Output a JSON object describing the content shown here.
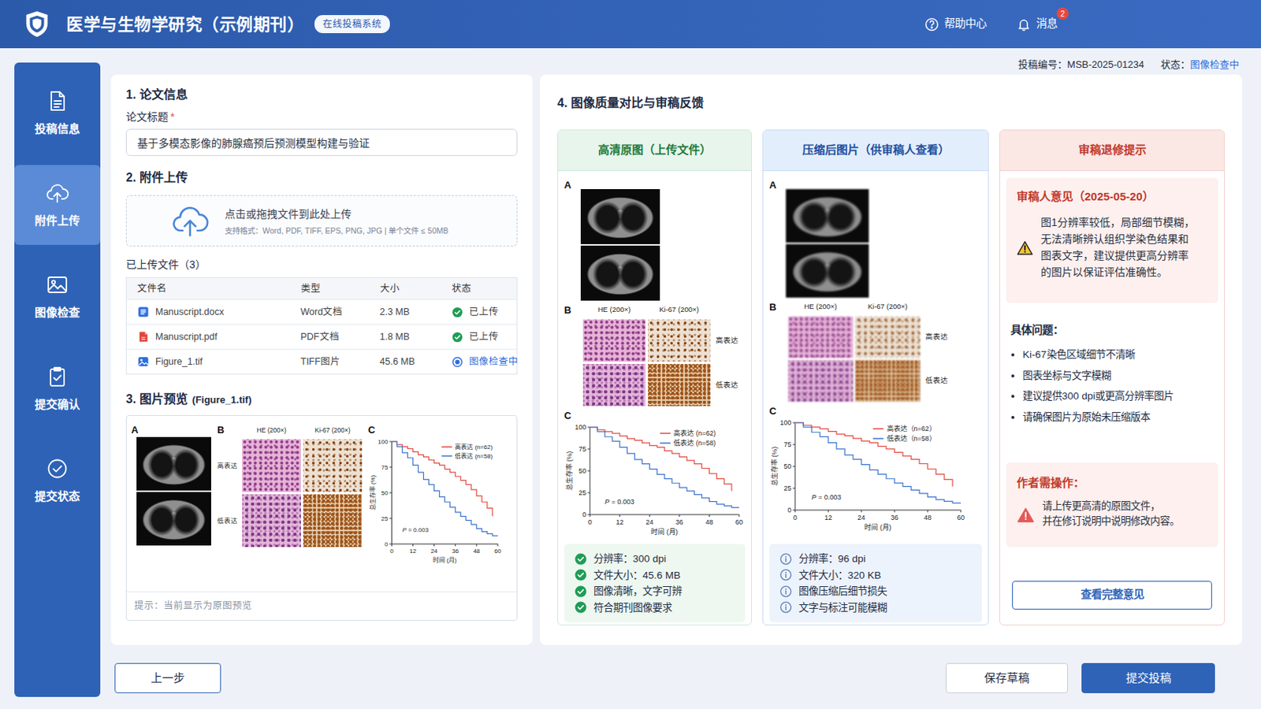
{
  "header": {
    "title": "医学与生物学研究（示例期刊）",
    "badge": "在线投稿系统",
    "help": "帮助中心",
    "messages": "消息",
    "message_count": "2"
  },
  "sidebar": {
    "items": [
      {
        "label": "投稿信息",
        "selected": false
      },
      {
        "label": "附件上传",
        "selected": true
      },
      {
        "label": "图像检查",
        "selected": false
      },
      {
        "label": "提交确认",
        "selected": false
      },
      {
        "label": "提交状态",
        "selected": false
      }
    ]
  },
  "submission": {
    "id_label": "投稿编号：",
    "id": "MSB-2025-01234",
    "status_label": "状态：",
    "status": "图像检查中"
  },
  "paper_info": {
    "heading": "1. 论文信息",
    "title_label": "论文标题",
    "required_mark": "*",
    "title_value": "基于多模态影像的肺腺癌预后预测模型构建与验证"
  },
  "upload": {
    "heading": "2. 附件上传",
    "drop_text": "点击或拖拽文件到此处上传",
    "drop_hint": "支持格式：Word, PDF, TIFF, EPS, PNG, JPG | 单个文件 ≤ 50MB"
  },
  "files": {
    "heading": "已上传文件（3）",
    "columns": [
      "文件名",
      "类型",
      "大小",
      "状态"
    ],
    "rows": [
      {
        "name": "Manuscript.docx",
        "type": "Word文档",
        "size": "2.3 MB",
        "status": "已上传",
        "kind": "word",
        "state": "done"
      },
      {
        "name": "Manuscript.pdf",
        "type": "PDF文档",
        "size": "1.8 MB",
        "status": "已上传",
        "kind": "pdf",
        "state": "done"
      },
      {
        "name": "Figure_1.tif",
        "type": "TIFF图片",
        "size": "45.6 MB",
        "status": "图像检查中",
        "kind": "image",
        "state": "checking"
      }
    ]
  },
  "preview": {
    "heading": "3. 图片预览",
    "file": "(Figure_1.tif)",
    "hint": "提示：当前显示为原图预览",
    "figure": {
      "a": "A",
      "b": "B",
      "c": "C",
      "he": "HE (200×)",
      "ki": "Ki-67 (200×)",
      "high": "高表达",
      "low": "低表达",
      "blurred": false,
      "chart": {
        "y_title": "总生存率 (%)",
        "x_title": "时间 (月)",
        "y_ticks": [
          "0",
          "25",
          "50",
          "75",
          "100"
        ],
        "x_ticks": [
          "0",
          "12",
          "24",
          "36",
          "48",
          "60"
        ],
        "p_label": "P",
        "p_value": "= 0.003",
        "series": [
          {
            "name": "高表达 (n=62)",
            "color": "#e5483f",
            "times": [
              0,
              3,
              6,
              9,
              12,
              15,
              18,
              21,
              24,
              27,
              30,
              33,
              36,
              39,
              42,
              45,
              48,
              51,
              54,
              57
            ],
            "values": [
              100,
              97,
              95,
              93,
              90,
              87,
              85,
              82,
              79,
              77,
              73,
              70,
              66,
              62,
              58,
              53,
              47,
              41,
              35,
              27
            ]
          },
          {
            "name": "低表达 (n=58)",
            "color": "#3a73cf",
            "times": [
              0,
              3,
              6,
              9,
              12,
              15,
              18,
              21,
              24,
              27,
              30,
              33,
              36,
              39,
              42,
              45,
              48,
              51,
              54,
              57,
              60
            ],
            "values": [
              100,
              95,
              89,
              84,
              77,
              70,
              63,
              58,
              52,
              46,
              41,
              36,
              31,
              27,
              23,
              19,
              15,
              12,
              10,
              8,
              8
            ]
          }
        ]
      }
    }
  },
  "compare": {
    "heading": "4. 图像质量对比与审稿反馈",
    "original": {
      "title": "高清原图（上传文件）",
      "figure": {
        "a": "A",
        "b": "B",
        "c": "C",
        "he": "HE (200×)",
        "ki": "Ki-67 (200×)",
        "high": "高表达",
        "low": "低表达",
        "blurred": false,
        "chart": {
          "y_title": "总生存率 (%)",
          "x_title": "时间 (月)",
          "y_ticks": [
            "0",
            "25",
            "50",
            "75",
            "100"
          ],
          "x_ticks": [
            "0",
            "12",
            "24",
            "36",
            "48",
            "60"
          ],
          "p_label": "P",
          "p_value": "= 0.003",
          "series": [
            {
              "name": "高表达 (n=62)",
              "color": "#e5483f",
              "times": [
                0,
                3,
                6,
                9,
                12,
                15,
                18,
                21,
                24,
                27,
                30,
                33,
                36,
                39,
                42,
                45,
                48,
                51,
                54,
                57
              ],
              "values": [
                100,
                97,
                95,
                93,
                90,
                87,
                85,
                82,
                79,
                77,
                73,
                70,
                66,
                62,
                58,
                53,
                47,
                41,
                35,
                27
              ]
            },
            {
              "name": "低表达 (n=58)",
              "color": "#3a73cf",
              "times": [
                0,
                3,
                6,
                9,
                12,
                15,
                18,
                21,
                24,
                27,
                30,
                33,
                36,
                39,
                42,
                45,
                48,
                51,
                54,
                57,
                60
              ],
              "values": [
                100,
                95,
                89,
                84,
                77,
                70,
                63,
                58,
                52,
                46,
                41,
                36,
                31,
                27,
                23,
                19,
                15,
                12,
                10,
                8,
                8
              ]
            }
          ]
        }
      },
      "checks": [
        {
          "text": "分辨率：300 dpi",
          "kind": "ok"
        },
        {
          "text": "文件大小：45.6 MB",
          "kind": "ok"
        },
        {
          "text": "图像清晰，文字可辨",
          "kind": "ok"
        },
        {
          "text": "符合期刊图像要求",
          "kind": "ok"
        }
      ]
    },
    "compressed": {
      "title": "压缩后图片（供审稿人查看）",
      "figure": {
        "a": "A",
        "b": "B",
        "c": "C",
        "he": "HE (200×)",
        "ki": "Ki-67 (200×)",
        "high": "高表达",
        "low": "低表达",
        "blurred": true,
        "chart": {
          "y_title": "总生存率 (%)",
          "x_title": "时间 (月)",
          "y_ticks": [
            "0",
            "25",
            "50",
            "75",
            "100"
          ],
          "x_ticks": [
            "0",
            "12",
            "24",
            "36",
            "48",
            "60"
          ],
          "p_label": "P",
          "p_value": "= 0.003",
          "series": [
            {
              "name": "高表达（n=62）",
              "color": "#e5483f",
              "times": [
                0,
                3,
                6,
                9,
                12,
                15,
                18,
                21,
                24,
                27,
                30,
                33,
                36,
                39,
                42,
                45,
                48,
                51,
                54,
                57
              ],
              "values": [
                100,
                97,
                95,
                93,
                90,
                87,
                85,
                82,
                79,
                77,
                73,
                70,
                66,
                62,
                58,
                53,
                47,
                41,
                35,
                27
              ]
            },
            {
              "name": "低表达（n=58）",
              "color": "#3a73cf",
              "times": [
                0,
                3,
                6,
                9,
                12,
                15,
                18,
                21,
                24,
                27,
                30,
                33,
                36,
                39,
                42,
                45,
                48,
                51,
                54,
                57,
                60
              ],
              "values": [
                100,
                95,
                89,
                84,
                77,
                70,
                63,
                58,
                52,
                46,
                41,
                36,
                31,
                27,
                23,
                19,
                15,
                12,
                10,
                8,
                8
              ]
            }
          ]
        }
      },
      "checks": [
        {
          "text": "分辨率：96 dpi",
          "kind": "info"
        },
        {
          "text": "文件大小：320 KB",
          "kind": "info"
        },
        {
          "text": "图像压缩后细节损失",
          "kind": "info"
        },
        {
          "text": "文字与标注可能模糊",
          "kind": "info"
        }
      ]
    },
    "review": {
      "title": "审稿退修提示",
      "opinion_title": "审稿人意见（2025-05-20）",
      "opinion": [
        "图1分辨率较低，局部细节模糊，",
        "无法清晰辨认组织学染色结果和",
        "图表文字，建议提供更高分辨率",
        "的图片以保证评估准确性。"
      ],
      "issues_title": "具体问题：",
      "issues": [
        "Ki-67染色区域细节不清晰",
        "图表坐标与文字模糊",
        "建议提供300 dpi或更高分辨率图片",
        "请确保图片为原始未压缩版本"
      ],
      "action_title": "作者需操作：",
      "action": [
        "请上传更高清的原图文件，",
        "并在修订说明中说明修改内容。"
      ],
      "button": "查看完整意见"
    }
  },
  "buttons": {
    "back": "上一步",
    "save": "保存草稿",
    "submit": "提交投稿"
  }
}
